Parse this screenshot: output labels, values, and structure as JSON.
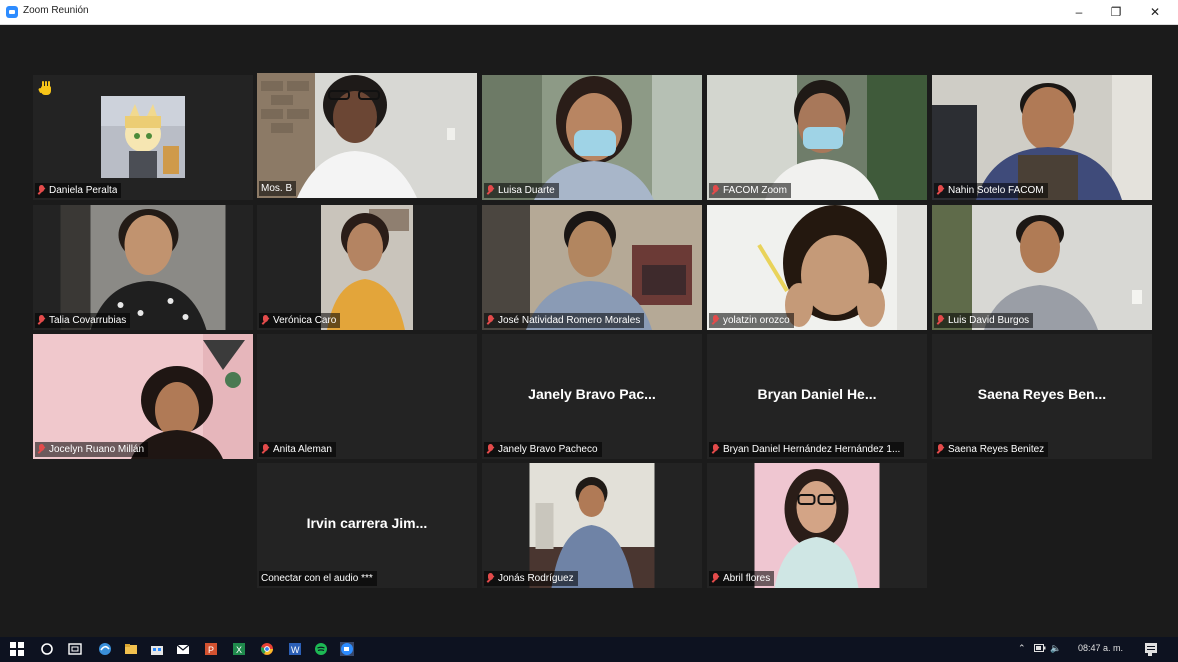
{
  "window": {
    "title": "Zoom Reunión"
  },
  "participants": [
    {
      "name": "Daniela Peralta"
    },
    {
      "name": "Mos. B"
    },
    {
      "name": "Luisa Duarte"
    },
    {
      "name": "FACOM Zoom"
    },
    {
      "name": "Nahin Sotelo FACOM"
    },
    {
      "name": "Talia Covarrubias"
    },
    {
      "name": "Verónica Caro"
    },
    {
      "name": "José Natividad Romero Morales"
    },
    {
      "name": "yolatzin orozco"
    },
    {
      "name": "Luis David Burgos"
    },
    {
      "name": "Jocelyn Ruano Millán"
    },
    {
      "name": "Anita Aleman"
    },
    {
      "name": "Janely Bravo Pacheco",
      "display": "Janely Bravo Pac..."
    },
    {
      "name": "Bryan Daniel Hernández Hernández 1...",
      "display": "Bryan Daniel He..."
    },
    {
      "name": "Saena Reyes Benitez",
      "display": "Saena Reyes Ben..."
    },
    {
      "name": "Conectar con el audio ***",
      "display": "Irvin carrera Jim..."
    },
    {
      "name": "Jonás Rodríguez"
    },
    {
      "name": "Abril flores"
    }
  ],
  "taskbar": {
    "time": "08:47 a. m."
  },
  "colors": {
    "active_speaker": "#b6d53a",
    "muted_mic": "#e34b4b",
    "raise_hand": "#f7c518",
    "zoom_blue": "#2d8cff"
  }
}
